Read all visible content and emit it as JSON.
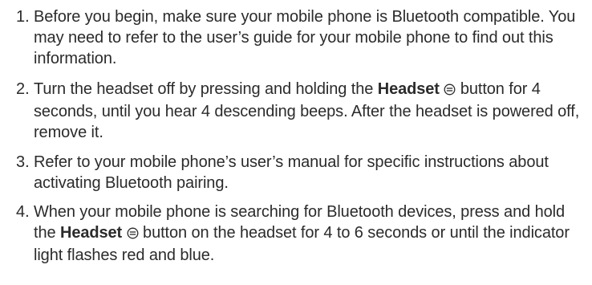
{
  "steps": [
    {
      "number": "1.",
      "text": "Before you begin, make sure your mobile phone is Bluetooth compatible. You may need to refer to the user’s guide for your mobile phone to find out this information."
    },
    {
      "number": "2.",
      "text_before": "Turn the headset off by pressing and holding the",
      "button_label": "Headset",
      "icon": "headset-button-icon",
      "text_after": "button for 4 seconds, until you hear 4 descending beeps. After the headset is powered off, remove it."
    },
    {
      "number": "3.",
      "text": "Refer to your mobile phone’s user’s manual for specific instructions about activating Bluetooth pairing."
    },
    {
      "number": "4.",
      "text_before": "When your mobile phone is searching for Bluetooth devices, press and hold the",
      "button_label": "Headset",
      "icon": "headset-button-icon",
      "text_after": "button on the headset for 4 to 6 seconds or until the indicator light flashes red and blue."
    }
  ]
}
